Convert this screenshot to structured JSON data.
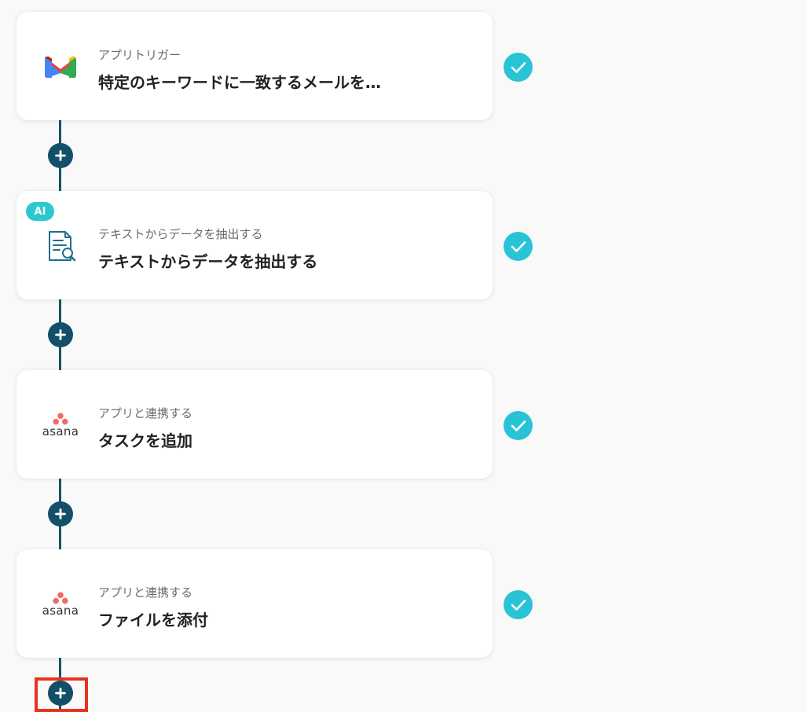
{
  "flow": {
    "steps": [
      {
        "id": "gmail-trigger",
        "subtitle": "アプリトリガー",
        "title": "特定のキーワードに一致するメールを…",
        "icon": "gmail-icon",
        "ai": false,
        "completed": true
      },
      {
        "id": "extract-data",
        "subtitle": "テキストからデータを抽出する",
        "title": "テキストからデータを抽出する",
        "icon": "document-search-icon",
        "ai": true,
        "ai_label": "AI",
        "completed": true
      },
      {
        "id": "asana-add-task",
        "subtitle": "アプリと連携する",
        "title": "タスクを追加",
        "icon": "asana-icon",
        "icon_text": "asana",
        "ai": false,
        "completed": true
      },
      {
        "id": "asana-attach-file",
        "subtitle": "アプリと連携する",
        "title": "ファイルを添付",
        "icon": "asana-icon",
        "icon_text": "asana",
        "ai": false,
        "completed": true
      }
    ],
    "add_step_icon": "plus-icon",
    "completed_icon": "check-icon"
  },
  "colors": {
    "connector": "#16536a",
    "plus_button": "#134f68",
    "check": "#29c3d6",
    "ai_badge": "#2cc8cf",
    "highlight": "#e8321f",
    "gmail_red": "#ea4335",
    "gmail_blue": "#4285f4",
    "gmail_green": "#34a853",
    "gmail_yellow": "#fbbc04",
    "asana_pink": "#f06a6a",
    "doc_icon": "#1f6f8b"
  }
}
